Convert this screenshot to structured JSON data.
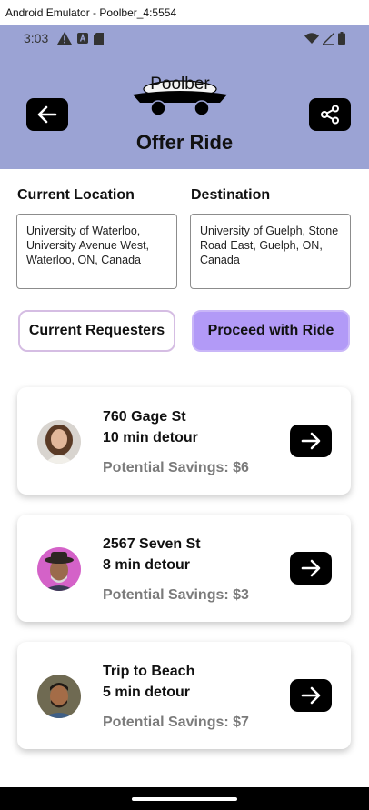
{
  "window": {
    "title": "Android Emulator - Poolber_4:5554"
  },
  "status_bar": {
    "time": "3:03",
    "left_icons": [
      "warning-icon",
      "a-notification-icon",
      "sd-card-icon"
    ],
    "right_icons": [
      "wifi-icon",
      "signal-icon",
      "battery-icon"
    ]
  },
  "header": {
    "logo_text": "Poolber",
    "title": "Offer Ride",
    "background": "#9ba3d4",
    "back_icon": "arrow-left-icon",
    "share_icon": "share-icon"
  },
  "locations": {
    "current_label": "Current Location",
    "current_value": "University of Waterloo, University Avenue West, Waterloo, ON, Canada",
    "destination_label": "Destination",
    "destination_value": "University of Guelph, Stone Road East, Guelph, ON, Canada"
  },
  "actions": {
    "requesters_label": "Current Requesters",
    "proceed_label": "Proceed with Ride",
    "accent": "#b29af7"
  },
  "requests": [
    {
      "title": "760 Gage St",
      "detour": "10 min detour",
      "savings": "Potential Savings: $6",
      "avatar": "avatar-woman-icon"
    },
    {
      "title": "2567 Seven St",
      "detour": "8 min detour",
      "savings": "Potential Savings: $3",
      "avatar": "avatar-man-hat-icon"
    },
    {
      "title": "Trip to Beach",
      "detour": "5 min detour",
      "savings": "Potential Savings: $7",
      "avatar": "avatar-man-icon"
    }
  ]
}
